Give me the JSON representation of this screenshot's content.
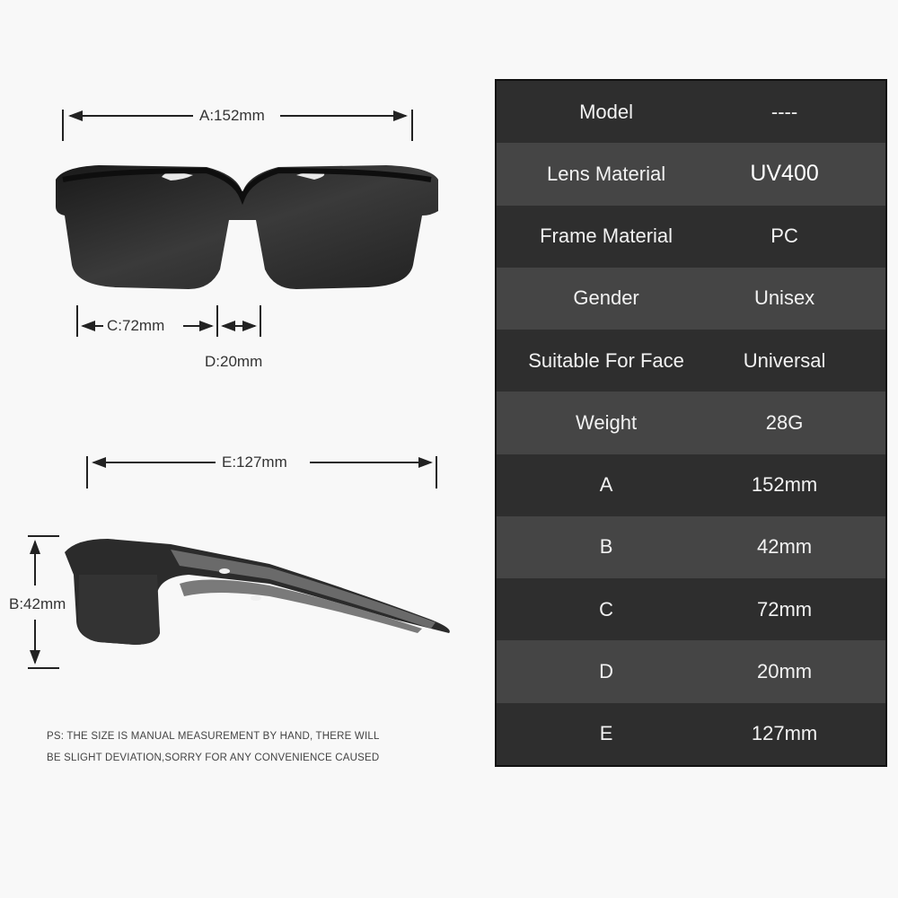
{
  "dimensions": {
    "a_label": "A:152mm",
    "c_label": "C:72mm",
    "d_label": "D:20mm",
    "e_label": "E:127mm",
    "b_label": "B:42mm"
  },
  "spec_table": {
    "rows": [
      {
        "label": "Model",
        "value": "----"
      },
      {
        "label": "Lens Material",
        "value": "UV400"
      },
      {
        "label": "Frame Material",
        "value": "PC"
      },
      {
        "label": "Gender",
        "value": "Unisex"
      },
      {
        "label": "Suitable For Face",
        "value": "Universal"
      },
      {
        "label": "Weight",
        "value": "28G"
      },
      {
        "label": "A",
        "value": "152mm"
      },
      {
        "label": "B",
        "value": "42mm"
      },
      {
        "label": "C",
        "value": "72mm"
      },
      {
        "label": "D",
        "value": "20mm"
      },
      {
        "label": "E",
        "value": "127mm"
      }
    ]
  },
  "note": {
    "line1": "PS: THE SIZE IS MANUAL MEASUREMENT BY HAND, THERE WILL",
    "line2": "BE SLIGHT DEVIATION,SORRY FOR ANY CONVENIENCE CAUSED"
  },
  "images": {
    "front_view": "sunglasses-front-view",
    "side_view": "sunglasses-side-view"
  }
}
